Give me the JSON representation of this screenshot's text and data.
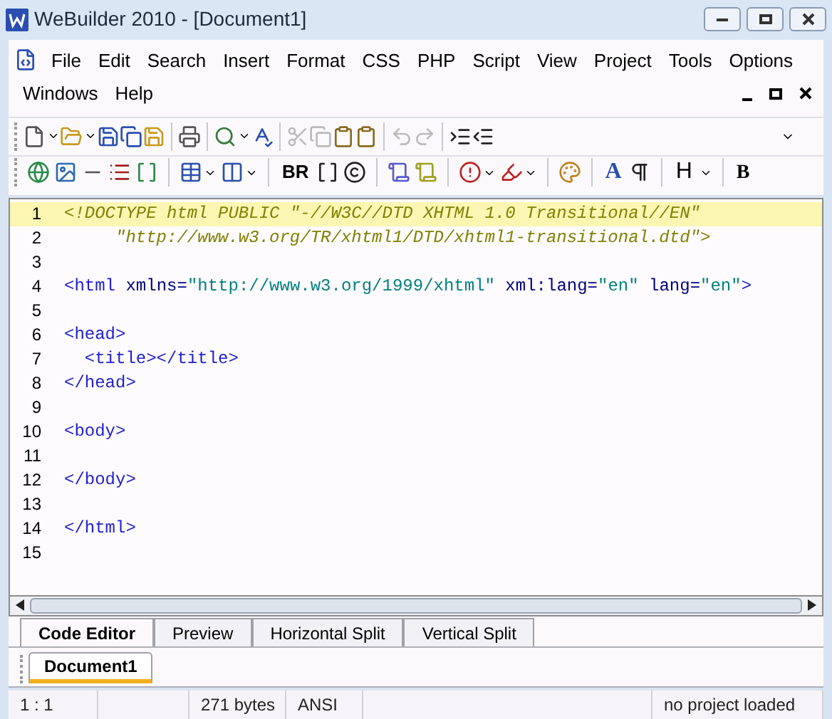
{
  "window": {
    "title": "WeBuilder 2010 - [Document1]"
  },
  "menu": [
    "File",
    "Edit",
    "Search",
    "Insert",
    "Format",
    "CSS",
    "PHP",
    "Script",
    "View",
    "Project",
    "Tools",
    "Options",
    "Windows",
    "Help"
  ],
  "toolbar_glyphs": [
    "BR",
    "A",
    "H",
    "B"
  ],
  "editor": {
    "lines": [
      {
        "number": "1",
        "highlighted": true,
        "segments": [
          {
            "kind": "doctype",
            "text": "<!DOCTYPE html PUBLIC \"-//W3C//DTD XHTML 1.0 Transitional//EN\""
          }
        ]
      },
      {
        "number": "2",
        "highlighted": false,
        "segments": [
          {
            "kind": "doctype",
            "text": "     \"http://www.w3.org/TR/xhtml1/DTD/xhtml1-transitional.dtd\">"
          }
        ]
      },
      {
        "number": "3",
        "highlighted": false
      },
      {
        "number": "4",
        "highlighted": false,
        "segments": [
          {
            "kind": "tag",
            "text": "<html "
          },
          {
            "kind": "attr",
            "text": "xmlns="
          },
          {
            "kind": "string",
            "text": "\"http://www.w3.org/1999/xhtml\""
          },
          {
            "kind": "attr",
            "text": " xml:lang="
          },
          {
            "kind": "string",
            "text": "\"en\""
          },
          {
            "kind": "attr",
            "text": " lang="
          },
          {
            "kind": "string",
            "text": "\"en\""
          },
          {
            "kind": "tag",
            "text": ">"
          }
        ]
      },
      {
        "number": "5",
        "highlighted": false
      },
      {
        "number": "6",
        "highlighted": false,
        "segments": [
          {
            "kind": "tag",
            "text": "<head>"
          }
        ]
      },
      {
        "number": "7",
        "highlighted": false,
        "segments": [
          {
            "kind": "tag",
            "text": "  <title></title>"
          }
        ]
      },
      {
        "number": "8",
        "highlighted": false,
        "segments": [
          {
            "kind": "tag",
            "text": "</head>"
          }
        ]
      },
      {
        "number": "9",
        "highlighted": false
      },
      {
        "number": "10",
        "highlighted": false,
        "segments": [
          {
            "kind": "tag",
            "text": "<body>"
          }
        ]
      },
      {
        "number": "11",
        "highlighted": false
      },
      {
        "number": "12",
        "highlighted": false,
        "segments": [
          {
            "kind": "tag",
            "text": "</body>"
          }
        ]
      },
      {
        "number": "13",
        "highlighted": false
      },
      {
        "number": "14",
        "highlighted": false,
        "segments": [
          {
            "kind": "tag",
            "text": "</html>"
          }
        ]
      },
      {
        "number": "15",
        "highlighted": false
      }
    ]
  },
  "view_tabs": [
    {
      "label": "Code Editor",
      "selected": true
    },
    {
      "label": "Preview",
      "selected": false
    },
    {
      "label": "Horizontal Split",
      "selected": false
    },
    {
      "label": "Vertical Split",
      "selected": false
    }
  ],
  "document_tabs": [
    {
      "label": "Document1",
      "selected": true
    }
  ],
  "status_bar": {
    "position": "1 : 1",
    "size": "271 bytes",
    "encoding": "ANSI",
    "project": "no project loaded"
  }
}
